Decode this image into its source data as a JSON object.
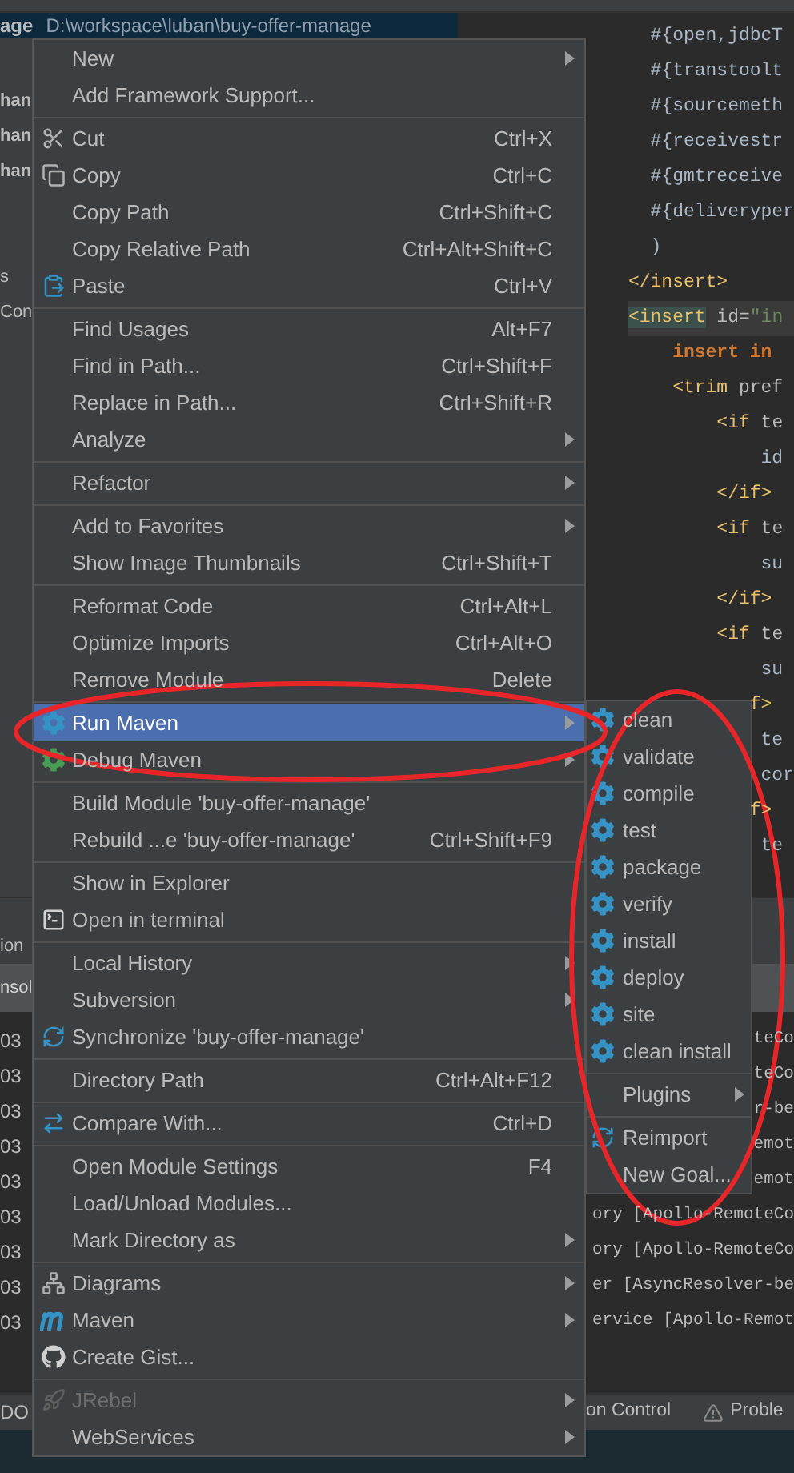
{
  "project_panel": {
    "header": {
      "name": "age",
      "path": "D:\\workspace\\luban\\buy-offer-manage"
    },
    "groups": [
      [
        {
          "label": "han",
          "bold": true
        },
        {
          "label": "han",
          "bold": true
        },
        {
          "label": "han",
          "bold": true
        }
      ],
      [
        {
          "label": "s",
          "bold": false
        },
        {
          "label": "Con",
          "bold": false
        }
      ]
    ]
  },
  "editor": {
    "lines": [
      {
        "current": false,
        "segments": [
          {
            "text": "  #{open,jdbcT",
            "kind": "plain"
          }
        ]
      },
      {
        "current": false,
        "segments": [
          {
            "text": "  #{transtoolt",
            "kind": "plain"
          }
        ]
      },
      {
        "current": false,
        "segments": [
          {
            "text": "  #{sourcemeth",
            "kind": "plain"
          }
        ]
      },
      {
        "current": false,
        "segments": [
          {
            "text": "  #{receivestr",
            "kind": "plain"
          }
        ]
      },
      {
        "current": false,
        "segments": [
          {
            "text": "  #{gmtreceive",
            "kind": "plain"
          }
        ]
      },
      {
        "current": false,
        "segments": [
          {
            "text": "  #{deliveryper",
            "kind": "plain"
          }
        ]
      },
      {
        "current": false,
        "segments": [
          {
            "text": "  )",
            "kind": "plain"
          }
        ]
      },
      {
        "current": false,
        "segments": [
          {
            "text": "</insert>",
            "kind": "tag"
          }
        ]
      },
      {
        "current": true,
        "segments": [
          {
            "text": "<insert",
            "kind": "tag_match"
          },
          {
            "text": " id=",
            "kind": "attr"
          },
          {
            "text": "\"in",
            "kind": "string"
          }
        ]
      },
      {
        "current": false,
        "segments": [
          {
            "text": "    insert in",
            "kind": "keyword"
          }
        ]
      },
      {
        "current": false,
        "segments": [
          {
            "text": "    <trim",
            "kind": "tag"
          },
          {
            "text": " pref",
            "kind": "attr"
          }
        ]
      },
      {
        "current": false,
        "segments": [
          {
            "text": "        <if",
            "kind": "tag"
          },
          {
            "text": " te",
            "kind": "attr"
          }
        ]
      },
      {
        "current": false,
        "segments": [
          {
            "text": "            id",
            "kind": "plain"
          }
        ]
      },
      {
        "current": false,
        "segments": [
          {
            "text": "        </if>",
            "kind": "tag"
          }
        ]
      },
      {
        "current": false,
        "segments": [
          {
            "text": "        <if",
            "kind": "tag"
          },
          {
            "text": " te",
            "kind": "attr"
          }
        ]
      },
      {
        "current": false,
        "segments": [
          {
            "text": "            su",
            "kind": "plain"
          }
        ]
      },
      {
        "current": false,
        "segments": [
          {
            "text": "        </if>",
            "kind": "tag"
          }
        ]
      },
      {
        "current": false,
        "segments": [
          {
            "text": "        <if",
            "kind": "tag"
          },
          {
            "text": " te",
            "kind": "attr"
          }
        ]
      },
      {
        "current": false,
        "segments": [
          {
            "text": "            su",
            "kind": "plain"
          }
        ]
      },
      {
        "current": false,
        "segments": [
          {
            "text": "           f>",
            "kind": "tag"
          }
        ]
      },
      {
        "current": false,
        "segments": [
          {
            "text": "            te",
            "kind": "plain"
          }
        ]
      },
      {
        "current": false,
        "segments": [
          {
            "text": "            cor",
            "kind": "plain"
          }
        ]
      },
      {
        "current": false,
        "segments": [
          {
            "text": "           f>",
            "kind": "tag"
          }
        ]
      },
      {
        "current": false,
        "segments": [
          {
            "text": "            te",
            "kind": "plain"
          }
        ]
      }
    ]
  },
  "tool_window": {
    "tabs": [
      {
        "label": "ion",
        "selected": false
      },
      {
        "label": "nsol",
        "selected": true
      }
    ],
    "rows": [
      {
        "time": "03",
        "message": "teCo"
      },
      {
        "time": "03",
        "message": "teCo"
      },
      {
        "time": "03",
        "message": "r-be"
      },
      {
        "time": "03",
        "message": "emot"
      },
      {
        "time": "03",
        "message": "emot"
      },
      {
        "time": "03",
        "message": "ory [Apollo-RemoteCo"
      },
      {
        "time": "03",
        "message": "ory [Apollo-RemoteCo"
      },
      {
        "time": "03",
        "message": "er [AsyncResolver-be"
      },
      {
        "time": "03",
        "message": "ervice [Apollo-Remot"
      }
    ]
  },
  "status_bar": {
    "left": "DO",
    "items": [
      {
        "label": "on Control",
        "kind": "plain"
      },
      {
        "label": "Proble",
        "kind": "warning"
      }
    ]
  },
  "context_menu": {
    "items": [
      {
        "kind": "item",
        "label": "New",
        "submenu": true,
        "selected": false,
        "disabled": false
      },
      {
        "kind": "item",
        "label": "Add Framework Support...",
        "submenu": false,
        "selected": false,
        "disabled": false
      },
      {
        "kind": "separator"
      },
      {
        "kind": "item",
        "label": "Cut",
        "shortcut": "Ctrl+X",
        "submenu": false,
        "selected": false,
        "disabled": false
      },
      {
        "kind": "item",
        "label": "Copy",
        "shortcut": "Ctrl+C",
        "submenu": false,
        "selected": false,
        "disabled": false
      },
      {
        "kind": "item",
        "label": "Copy Path",
        "shortcut": "Ctrl+Shift+C",
        "submenu": false,
        "selected": false,
        "disabled": false
      },
      {
        "kind": "item",
        "label": "Copy Relative Path",
        "shortcut": "Ctrl+Alt+Shift+C",
        "submenu": false,
        "selected": false,
        "disabled": false
      },
      {
        "kind": "item",
        "label": "Paste",
        "shortcut": "Ctrl+V",
        "submenu": false,
        "selected": false,
        "disabled": false
      },
      {
        "kind": "separator"
      },
      {
        "kind": "item",
        "label": "Find Usages",
        "shortcut": "Alt+F7",
        "submenu": false,
        "selected": false,
        "disabled": false
      },
      {
        "kind": "item",
        "label": "Find in Path...",
        "shortcut": "Ctrl+Shift+F",
        "submenu": false,
        "selected": false,
        "disabled": false
      },
      {
        "kind": "item",
        "label": "Replace in Path...",
        "shortcut": "Ctrl+Shift+R",
        "submenu": false,
        "selected": false,
        "disabled": false
      },
      {
        "kind": "item",
        "label": "Analyze",
        "submenu": true,
        "selected": false,
        "disabled": false
      },
      {
        "kind": "separator"
      },
      {
        "kind": "item",
        "label": "Refactor",
        "submenu": true,
        "selected": false,
        "disabled": false
      },
      {
        "kind": "separator"
      },
      {
        "kind": "item",
        "label": "Add to Favorites",
        "submenu": true,
        "selected": false,
        "disabled": false
      },
      {
        "kind": "item",
        "label": "Show Image Thumbnails",
        "shortcut": "Ctrl+Shift+T",
        "submenu": false,
        "selected": false,
        "disabled": false
      },
      {
        "kind": "separator"
      },
      {
        "kind": "item",
        "label": "Reformat Code",
        "shortcut": "Ctrl+Alt+L",
        "submenu": false,
        "selected": false,
        "disabled": false
      },
      {
        "kind": "item",
        "label": "Optimize Imports",
        "shortcut": "Ctrl+Alt+O",
        "submenu": false,
        "selected": false,
        "disabled": false
      },
      {
        "kind": "item",
        "label": "Remove Module",
        "shortcut": "Delete",
        "submenu": false,
        "selected": false,
        "disabled": false
      },
      {
        "kind": "separator"
      },
      {
        "kind": "item",
        "label": "Run Maven",
        "submenu": true,
        "selected": true,
        "disabled": false
      },
      {
        "kind": "item",
        "label": "Debug Maven",
        "submenu": true,
        "selected": false,
        "disabled": false
      },
      {
        "kind": "separator"
      },
      {
        "kind": "item",
        "label": "Build Module 'buy-offer-manage'",
        "submenu": false,
        "selected": false,
        "disabled": false
      },
      {
        "kind": "item",
        "label": "Rebuild ...e 'buy-offer-manage'",
        "shortcut": "Ctrl+Shift+F9",
        "submenu": false,
        "selected": false,
        "disabled": false
      },
      {
        "kind": "separator"
      },
      {
        "kind": "item",
        "label": "Show in Explorer",
        "submenu": false,
        "selected": false,
        "disabled": false
      },
      {
        "kind": "item",
        "label": "Open in terminal",
        "submenu": false,
        "selected": false,
        "disabled": false
      },
      {
        "kind": "separator"
      },
      {
        "kind": "item",
        "label": "Local History",
        "submenu": true,
        "selected": false,
        "disabled": false
      },
      {
        "kind": "item",
        "label": "Subversion",
        "submenu": true,
        "selected": false,
        "disabled": false
      },
      {
        "kind": "item",
        "label": "Synchronize 'buy-offer-manage'",
        "submenu": false,
        "selected": false,
        "disabled": false
      },
      {
        "kind": "separator"
      },
      {
        "kind": "item",
        "label": "Directory Path",
        "shortcut": "Ctrl+Alt+F12",
        "submenu": false,
        "selected": false,
        "disabled": false
      },
      {
        "kind": "separator"
      },
      {
        "kind": "item",
        "label": "Compare With...",
        "shortcut": "Ctrl+D",
        "submenu": false,
        "selected": false,
        "disabled": false
      },
      {
        "kind": "separator"
      },
      {
        "kind": "item",
        "label": "Open Module Settings",
        "shortcut": "F4",
        "submenu": false,
        "selected": false,
        "disabled": false
      },
      {
        "kind": "item",
        "label": "Load/Unload Modules...",
        "submenu": false,
        "selected": false,
        "disabled": false
      },
      {
        "kind": "item",
        "label": "Mark Directory as",
        "submenu": true,
        "selected": false,
        "disabled": false
      },
      {
        "kind": "separator"
      },
      {
        "kind": "item",
        "label": "Diagrams",
        "submenu": true,
        "selected": false,
        "disabled": false
      },
      {
        "kind": "item",
        "label": "Maven",
        "submenu": true,
        "selected": false,
        "disabled": false
      },
      {
        "kind": "item",
        "label": "Create Gist...",
        "submenu": false,
        "selected": false,
        "disabled": false
      },
      {
        "kind": "separator"
      },
      {
        "kind": "item",
        "label": "JRebel",
        "submenu": true,
        "selected": false,
        "disabled": true
      },
      {
        "kind": "item",
        "label": "WebServices",
        "submenu": true,
        "selected": false,
        "disabled": false
      }
    ]
  },
  "submenu": {
    "items": [
      {
        "kind": "item",
        "label": "clean",
        "submenu": false
      },
      {
        "kind": "item",
        "label": "validate",
        "submenu": false
      },
      {
        "kind": "item",
        "label": "compile",
        "submenu": false
      },
      {
        "kind": "item",
        "label": "test",
        "submenu": false
      },
      {
        "kind": "item",
        "label": "package",
        "submenu": false
      },
      {
        "kind": "item",
        "label": "verify",
        "submenu": false
      },
      {
        "kind": "item",
        "label": "install",
        "submenu": false
      },
      {
        "kind": "item",
        "label": "deploy",
        "submenu": false
      },
      {
        "kind": "item",
        "label": "site",
        "submenu": false
      },
      {
        "kind": "item",
        "label": "clean install",
        "submenu": false
      },
      {
        "kind": "separator"
      },
      {
        "kind": "item",
        "label": "Plugins",
        "submenu": true
      },
      {
        "kind": "separator"
      },
      {
        "kind": "item",
        "label": "Reimport",
        "submenu": false
      },
      {
        "kind": "item",
        "label": "New Goal...",
        "submenu": false
      }
    ]
  }
}
